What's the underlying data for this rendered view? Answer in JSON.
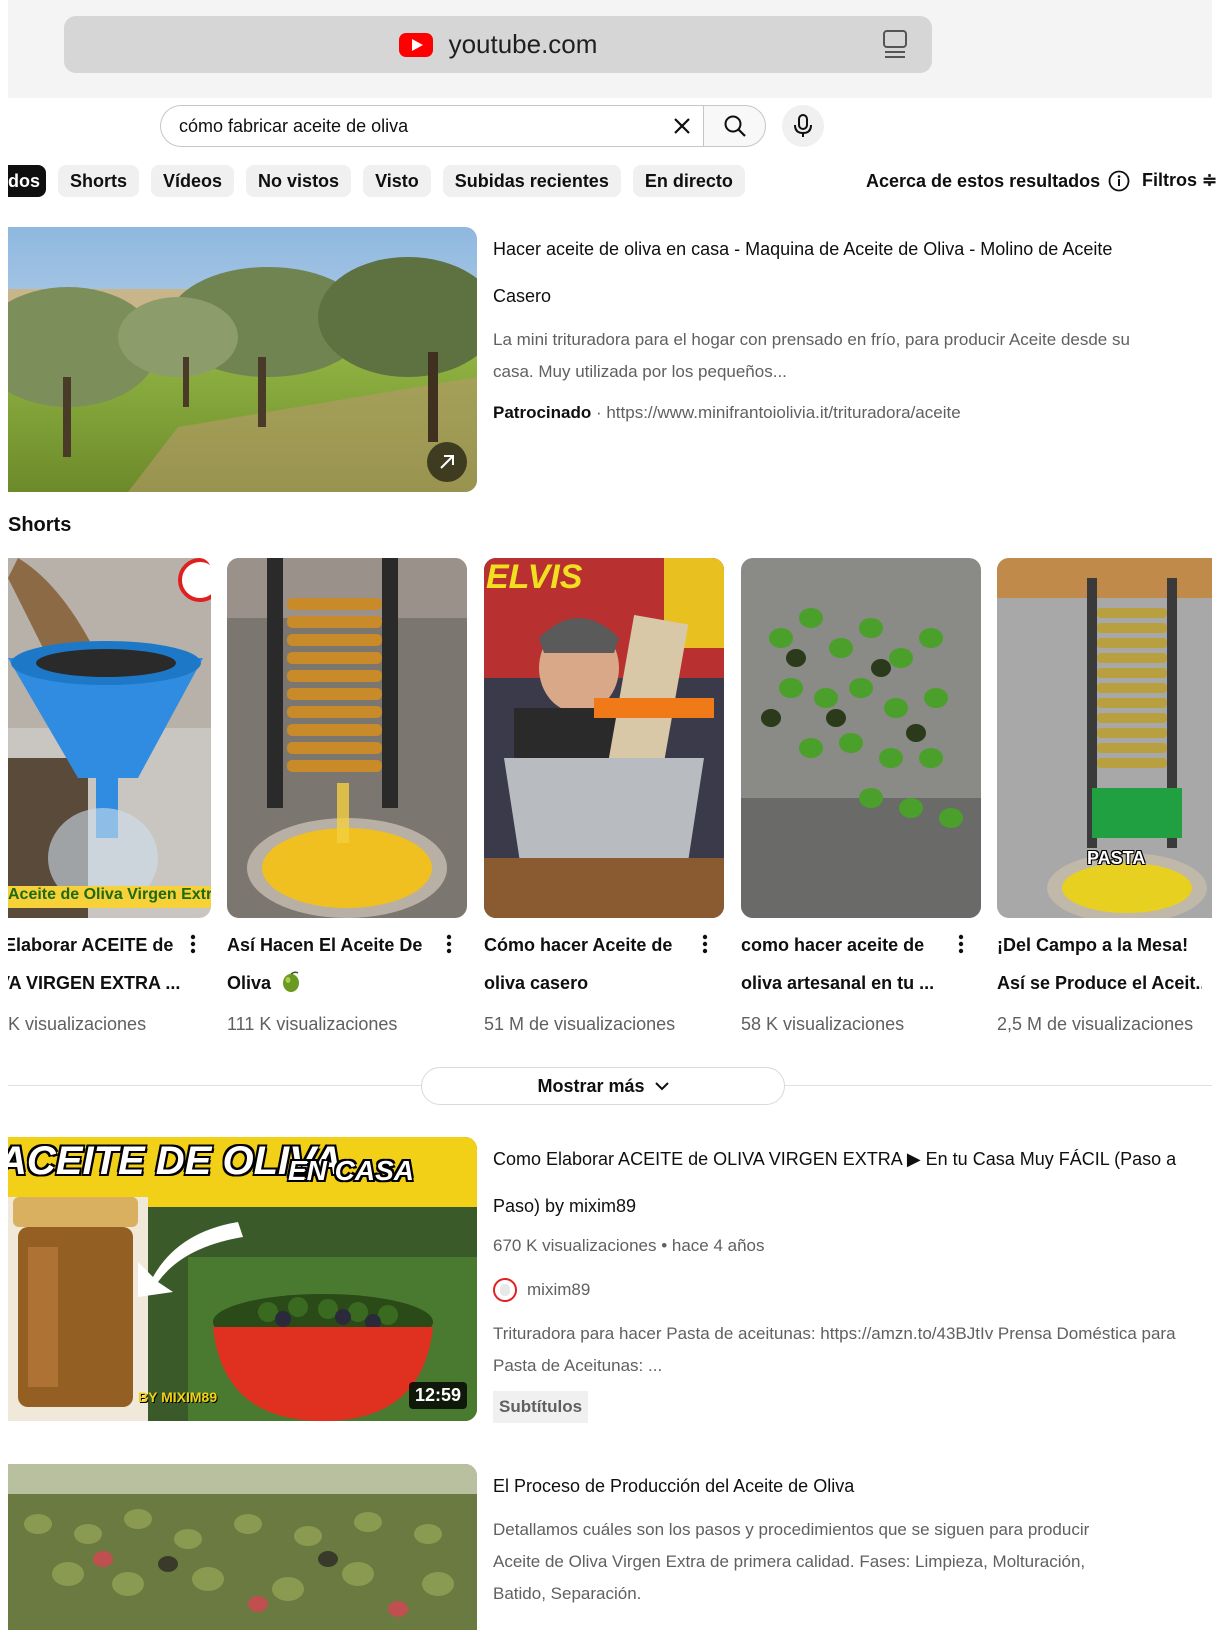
{
  "browser": {
    "url": "youtube.com"
  },
  "search": {
    "query": "cómo fabricar aceite de oliva"
  },
  "chips": [
    "dos",
    "Shorts",
    "Vídeos",
    "No vistos",
    "Visto",
    "Subidas recientes",
    "En directo"
  ],
  "header": {
    "about_label": "Acerca de estos resultados",
    "filters_label": "Filtros"
  },
  "ad": {
    "title_line1": "Hacer aceite de oliva en casa - Maquina de Aceite de Oliva - Molino de Aceite",
    "title_line2": "Casero",
    "desc_line1": "La mini trituradora para el hogar con prensado en frío, para producir Aceite desde su",
    "desc_line2": "casa. Muy utilizada por los pequeños...",
    "sponsored": "Patrocinado",
    "link": " · https://www.minifrantoiolivia.it/trituradora/aceite"
  },
  "shorts": {
    "title": "Shorts",
    "items": [
      {
        "line1": "Elaborar ACEITE de",
        "line2": "VA VIRGEN EXTRA ...",
        "views": "K visualizaciones",
        "overlay": "Aceite de Oliva Virgen Extra"
      },
      {
        "line1": "Así Hacen El Aceite De",
        "line2": "Oliva",
        "views": "111 K visualizaciones"
      },
      {
        "line1": "Cómo hacer Aceite de",
        "line2": "oliva casero",
        "views": "51 M de visualizaciones",
        "overlay": "ELVIS"
      },
      {
        "line1": "como hacer aceite de",
        "line2": "oliva artesanal en tu ...",
        "views": "58 K visualizaciones"
      },
      {
        "line1": "¡Del Campo a la Mesa!",
        "line2": "Así se Produce el Aceit...",
        "views": "2,5 M de visualizaciones",
        "overlay": "PASTA"
      }
    ]
  },
  "show_more": "Mostrar más",
  "video1": {
    "title_line1": "Como Elaborar ACEITE de OLIVA VIRGEN EXTRA ▶ En tu Casa Muy FÁCIL (Paso a",
    "title_line2": "Paso) by mixim89",
    "meta": "670 K visualizaciones • hace 4 años",
    "channel": "mixim89",
    "desc_line1": "Trituradora para hacer Pasta de aceitunas: https://amzn.to/43BJtIv Prensa Doméstica para",
    "desc_line2": "Pasta de Aceitunas: ...",
    "badge": "Subtítulos",
    "duration": "12:59",
    "thumb_text1": "ACEITE DE OLIVA",
    "thumb_text2": "EN CASA",
    "thumb_text3": "BY MIXIM89"
  },
  "ad2": {
    "title": "El Proceso de Producción del Aceite de Oliva",
    "desc_line1": "Detallamos cuáles son los pasos y procedimientos que se siguen para producir",
    "desc_line2": "Aceite de Oliva Virgen Extra de primera calidad. Fases: Limpieza, Molturación,",
    "desc_line3": "Batido, Separación."
  }
}
